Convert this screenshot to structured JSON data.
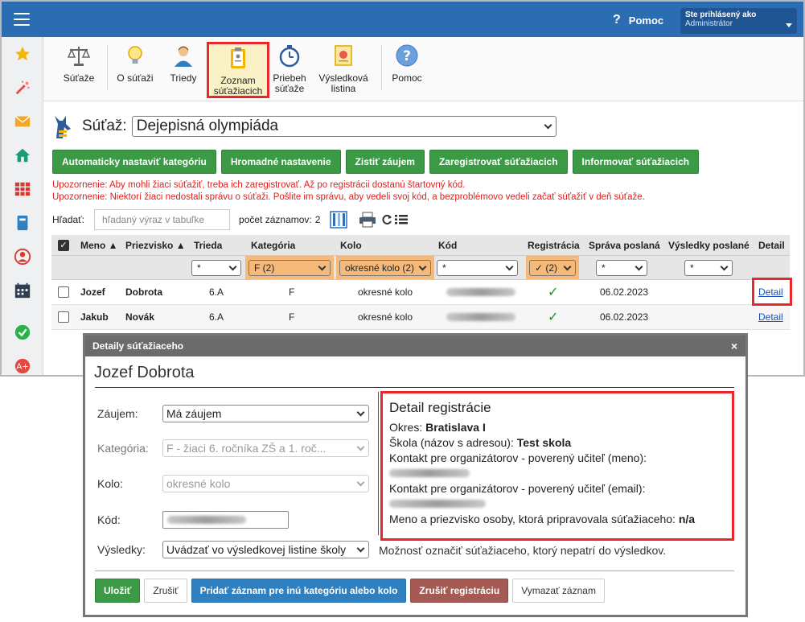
{
  "header": {
    "help_label": "Pomoc",
    "user_line1": "Ste prihlásený ako",
    "user_line2": "Administrátor"
  },
  "toolbar": [
    {
      "label": "Súťaže"
    },
    {
      "label": "O súťaži"
    },
    {
      "label": "Triedy"
    },
    {
      "label": "Zoznam súťažiacich",
      "active": true
    },
    {
      "label": "Priebeh súťaže"
    },
    {
      "label": "Výsledková listina"
    },
    {
      "label": "Pomoc"
    }
  ],
  "contest": {
    "label": "Súťaž:",
    "selected": "Dejepisná olympiáda"
  },
  "actions": [
    "Automaticky nastaviť kategóriu",
    "Hromadné nastavenie",
    "Zistiť záujem",
    "Zaregistrovať súťažiacich",
    "Informovať súťažiacich"
  ],
  "warnings": [
    "Upozornenie: Aby mohli žiaci súťažiť, treba ich zaregistrovať. Až po registrácii dostanú štartovný kód.",
    "Upozornenie: Niektorí žiaci nedostali správu o súťaži. Pošlite im správu, aby vedeli svoj kód, a bezproblémovo vedeli začať súťažiť v deň súťaže."
  ],
  "search": {
    "label": "Hľadať:",
    "placeholder": "hľadaný výraz v tabuľke",
    "count_label": "počet záznamov:",
    "count_value": "2"
  },
  "table": {
    "headers": [
      "Meno",
      "Priezvisko",
      "Trieda",
      "Kategória",
      "Kolo",
      "Kód",
      "Registrácia",
      "Správa poslaná",
      "Výsledky poslané",
      "Detail"
    ],
    "filters": {
      "trieda": "*",
      "kategoria": "F (2)",
      "kolo": "okresné kolo (2)",
      "kod": "*",
      "registracia": "✓ (2)",
      "sprava": "*",
      "vysledky": "*"
    },
    "rows": [
      {
        "meno": "Jozef",
        "priezvisko": "Dobrota",
        "trieda": "6.A",
        "kategoria": "F",
        "kolo": "okresné kolo",
        "registracia": "✓",
        "sprava": "06.02.2023",
        "detail": "Detail"
      },
      {
        "meno": "Jakub",
        "priezvisko": "Novák",
        "trieda": "6.A",
        "kategoria": "F",
        "kolo": "okresné kolo",
        "registracia": "✓",
        "sprava": "06.02.2023",
        "detail": "Detail"
      }
    ]
  },
  "modal": {
    "title": "Detaily súťažiaceho",
    "close": "×",
    "name": "Jozef Dobrota",
    "fields": {
      "zaujem_label": "Záujem:",
      "zaujem_value": "Má záujem",
      "kategoria_label": "Kategória:",
      "kategoria_value": "F - žiaci 6. ročníka ZŠ a 1. roč...",
      "kolo_label": "Kolo:",
      "kolo_value": "okresné kolo",
      "kod_label": "Kód:",
      "vysledky_label": "Výsledky:",
      "vysledky_value": "Uvádzať vo výsledkovej listine školy"
    },
    "registration": {
      "title": "Detail registrácie",
      "okres_label": "Okres:",
      "okres_value": "Bratislava I",
      "skola_label": "Škola (názov s adresou):",
      "skola_value": "Test skola",
      "kontakt_meno_label": "Kontakt pre organizátorov - poverený učiteľ (meno):",
      "kontakt_email_label": "Kontakt pre organizátorov - poverený učiteľ (email):",
      "pripravoval_label": "Meno a priezvisko osoby, ktorá pripravovala súťažiaceho:",
      "pripravoval_value": "n/a"
    },
    "note": "Možnosť označiť súťažiaceho, ktorý nepatrí do výsledkov.",
    "buttons": {
      "save": "Uložiť",
      "cancel": "Zrušiť",
      "add": "Pridať záznam pre inú kategóriu alebo kolo",
      "unregister": "Zrušiť registráciu",
      "delete": "Vymazať záznam"
    }
  },
  "colors": {
    "topbar": "#2b6cb3",
    "green": "#3c9a46",
    "highlight": "#e8262b",
    "warning": "#e02020"
  }
}
